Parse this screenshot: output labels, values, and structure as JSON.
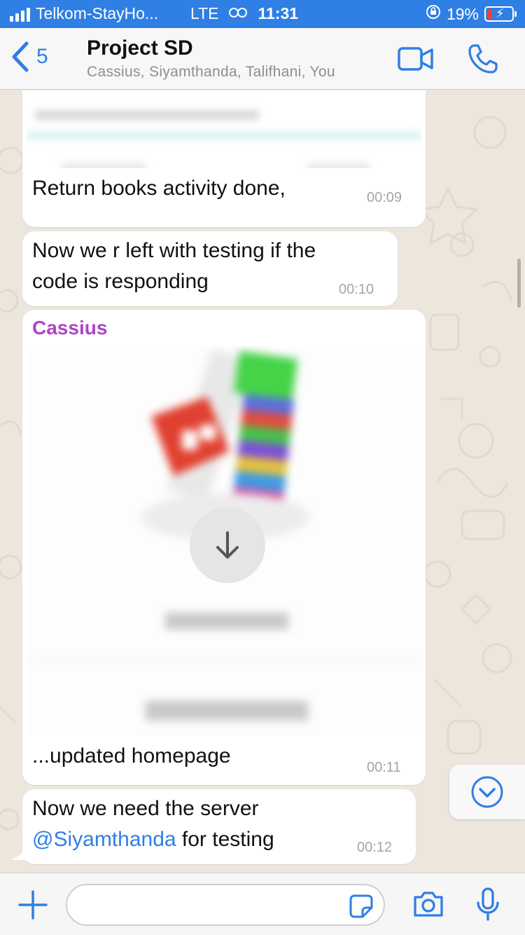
{
  "status_bar": {
    "carrier": "Telkom-StayHo...",
    "network": "LTE",
    "time": "11:31",
    "battery": "19%"
  },
  "header": {
    "back_count": "5",
    "title": "Project SD",
    "members": "Cassius, Siyamthanda, Talifhani, You"
  },
  "messages": [
    {
      "text": "Return books activity done,",
      "time": "00:09"
    },
    {
      "text_line1": "Now we r left with testing if the",
      "text_line2": "code is responding",
      "time": "00:10"
    },
    {
      "sender": "Cassius",
      "caption": "...updated homepage",
      "time": "00:11"
    },
    {
      "text_line1": "Now we need the server",
      "mention": "@Siyamthanda",
      "text_after_mention": " for testing",
      "time": "00:12"
    }
  ],
  "colors": {
    "accent": "#2f7fe4",
    "sender_name": "#b042c8",
    "battery_low": "#ff3b30"
  },
  "icons": [
    "signal-icon",
    "vpn-icon",
    "orientation-lock-icon",
    "battery-icon",
    "back-chevron-icon",
    "video-call-icon",
    "phone-call-icon",
    "download-arrow-icon",
    "scroll-down-icon",
    "plus-icon",
    "sticker-icon",
    "camera-icon",
    "microphone-icon"
  ]
}
